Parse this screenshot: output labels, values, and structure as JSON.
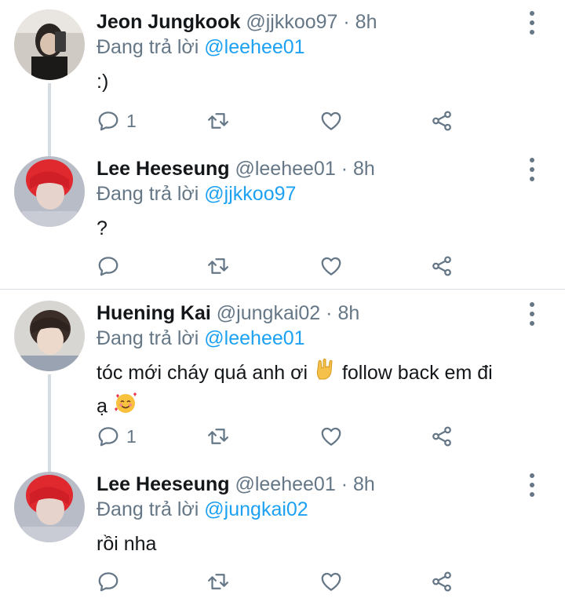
{
  "tweets": [
    {
      "name": "Jeon Jungkook",
      "handle": "@jjkkoo97",
      "dot": "·",
      "time": "8h",
      "reply_prefix": "Đang trả lời",
      "reply_to": "@leehee01",
      "text": ":)",
      "reply_count": "1",
      "avatar_icon": "avatar-photo"
    },
    {
      "name": "Lee Heeseung",
      "handle": "@leehee01",
      "dot": "·",
      "time": "8h",
      "reply_prefix": "Đang trả lời",
      "reply_to": "@jjkkoo97",
      "text": "?",
      "reply_count": "",
      "avatar_icon": "avatar-photo"
    },
    {
      "name": "Huening Kai",
      "handle": "@jungkai02",
      "dot": "·",
      "time": "8h",
      "reply_prefix": "Đang trả lời",
      "reply_to": "@leehee01",
      "text_part1": "tóc mới cháy quá anh ơi",
      "text_part2": "follow back em đi",
      "text_part3": "ạ",
      "emoji1": "rock-on-hand-emoji",
      "emoji2": "smiling-face-with-hearts-emoji",
      "reply_count": "1",
      "avatar_icon": "avatar-photo"
    },
    {
      "name": "Lee Heeseung",
      "handle": "@leehee01",
      "dot": "·",
      "time": "8h",
      "reply_prefix": "Đang trả lời",
      "reply_to": "@jungkai02",
      "text": "rồi nha",
      "reply_count": "",
      "avatar_icon": "avatar-photo"
    }
  ],
  "colors": {
    "mention": "#1da1f2",
    "muted": "#657786",
    "thread_line": "#d5dce2"
  }
}
